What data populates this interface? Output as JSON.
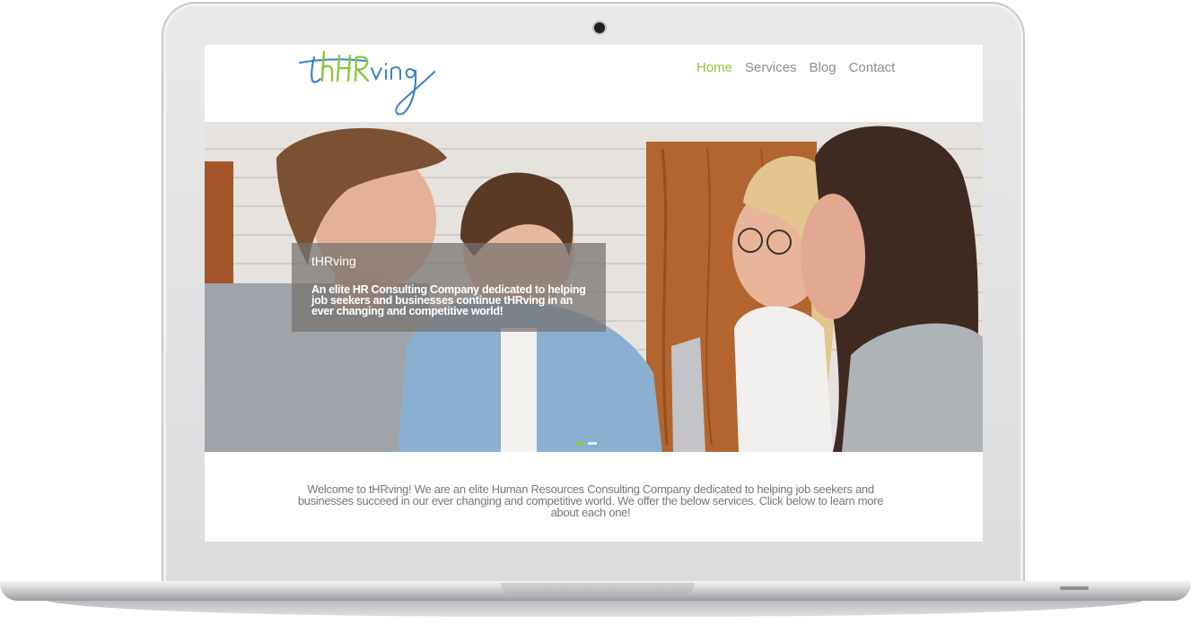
{
  "brand": {
    "logo_text": "tHRving",
    "colors": {
      "accent_green": "#8cc63f",
      "logo_blue": "#3a82c4",
      "nav_gray": "#8c8c8c"
    }
  },
  "nav": {
    "items": [
      {
        "label": "Home",
        "active": true
      },
      {
        "label": "Services",
        "active": false
      },
      {
        "label": "Blog",
        "active": false
      },
      {
        "label": "Contact",
        "active": false
      }
    ]
  },
  "hero": {
    "title": "tHRving",
    "text": "An elite HR Consulting Company dedicated to helping job seekers and businesses continue tHRving in an ever changing and competitive world!",
    "slides": {
      "count": 2,
      "active_index": 0
    }
  },
  "welcome": {
    "text": "Welcome to tHRving! We are an elite Human Resources Consulting Company dedicated to helping job seekers and businesses succeed in our ever changing and competitive world. We offer the below services. Click below to learn more about each one!"
  }
}
